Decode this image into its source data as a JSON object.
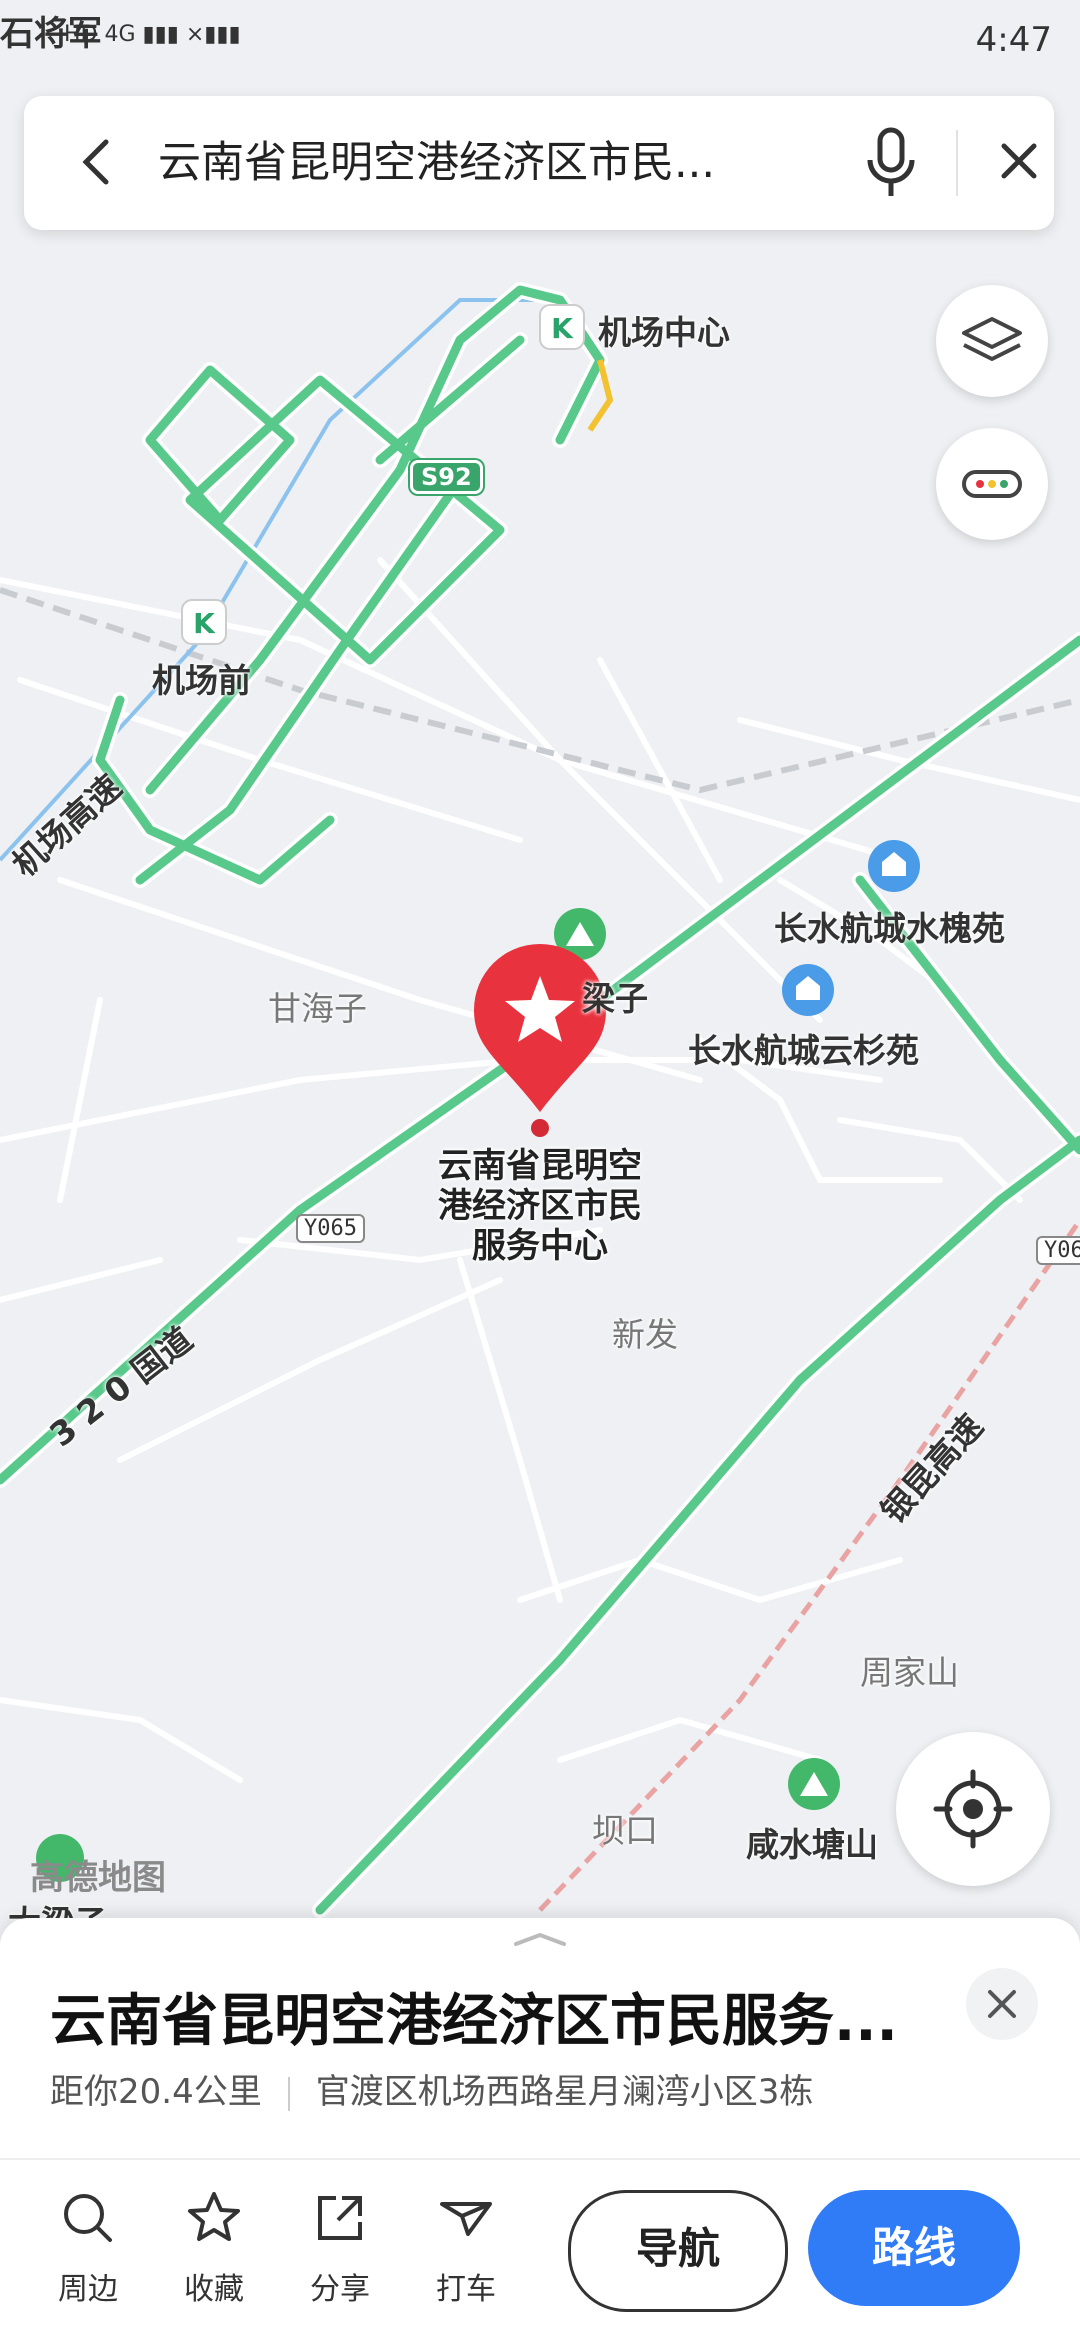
{
  "status_bar": {
    "carrier_text": "石将军",
    "signal_text": "HD 4G ▮▮▮ ×▮▮▮",
    "time": "4:47"
  },
  "search": {
    "query": "云南省昆明空港经济区市民...",
    "back_icon": "back-arrow-icon",
    "mic_icon": "microphone-icon",
    "close_icon": "close-icon"
  },
  "map_controls": {
    "layers_icon": "layers-icon",
    "traffic_icon": "traffic-icon",
    "locate_icon": "locate-icon"
  },
  "map_labels": {
    "airport_center": "机场中心",
    "airport_front": "机场前",
    "airport_expressway": "机场高速",
    "ganhaizi": "甘海子",
    "liangzi": "梁子",
    "shuihuaiyuan": "长水航城水槐苑",
    "yunshanyuan": "长水航城云杉苑",
    "xinfa": "新发",
    "national_road": "3 2 0 国道",
    "yinkun_expressway": "银昆高速",
    "zhoujiashan": "周家山",
    "bakou": "坝口",
    "xianshuitangshan": "咸水塘山",
    "dalangzi": "大梁子",
    "road_s92": "S92",
    "road_y065": "Y065",
    "road_y06": "Y06"
  },
  "poi": {
    "name_line1": "云南省昆明空",
    "name_line2": "港经济区市民",
    "name_line3": "服务中心"
  },
  "brand": "高德地图",
  "detail_sheet": {
    "title": "云南省昆明空港经济区市民服务...",
    "distance": "距你20.4公里",
    "address": "官渡区机场西路星月澜湾小区3栋",
    "actions": [
      {
        "icon": "search-icon",
        "label": "周边"
      },
      {
        "icon": "star-icon",
        "label": "收藏"
      },
      {
        "icon": "share-icon",
        "label": "分享"
      },
      {
        "icon": "taxi-icon",
        "label": "打车"
      }
    ],
    "navigate_label": "导航",
    "route_label": "路线"
  },
  "colors": {
    "road_green": "#58c98b",
    "marker_red": "#e8333f",
    "route_blue": "#2f7cf6"
  }
}
